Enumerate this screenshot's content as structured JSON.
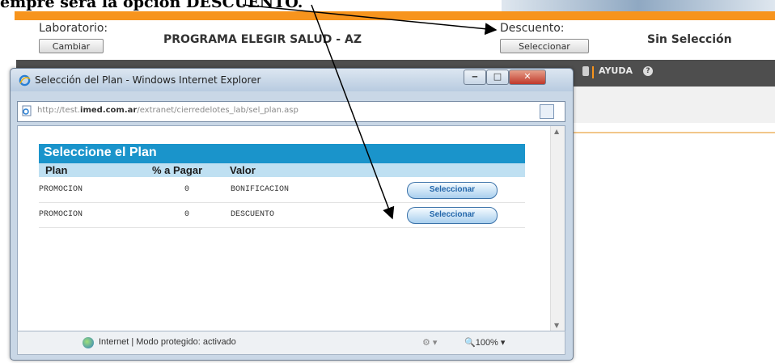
{
  "caption": "empre será la opción DESCUENTO.",
  "header": {
    "lab_label": "Laboratorio:",
    "lab_button": "Cambiar",
    "program_title": "PROGRAMA ELEGIR SALUD - AZ",
    "descuento_label": "Descuento:",
    "descuento_button": "Seleccionar",
    "selection_status": "Sin Selección"
  },
  "navbar": {
    "help_label": "AYUDA"
  },
  "popup": {
    "window_title": "Selección del Plan - Windows Internet Explorer",
    "url_prefix": "http://test.",
    "url_domain": "imed.com.ar",
    "url_path": "/extranet/cierredelotes_lab/sel_plan.asp",
    "section_title": "Seleccione el Plan",
    "columns": {
      "plan": "Plan",
      "pct": "% a Pagar",
      "valor": "Valor"
    },
    "rows": [
      {
        "plan": "PROMOCION",
        "pct": "0",
        "valor": "BONIFICACION",
        "button": "Seleccionar"
      },
      {
        "plan": "PROMOCION",
        "pct": "0",
        "valor": "DESCUENTO",
        "button": "Seleccionar"
      }
    ],
    "status_text": "Internet | Modo protegido: activado",
    "zoom": "100%"
  },
  "colors": {
    "orange": "#f7941d",
    "blue_header": "#1a94cb",
    "light_blue": "#bfe0f2",
    "nav_dark": "#4e4e4e"
  }
}
